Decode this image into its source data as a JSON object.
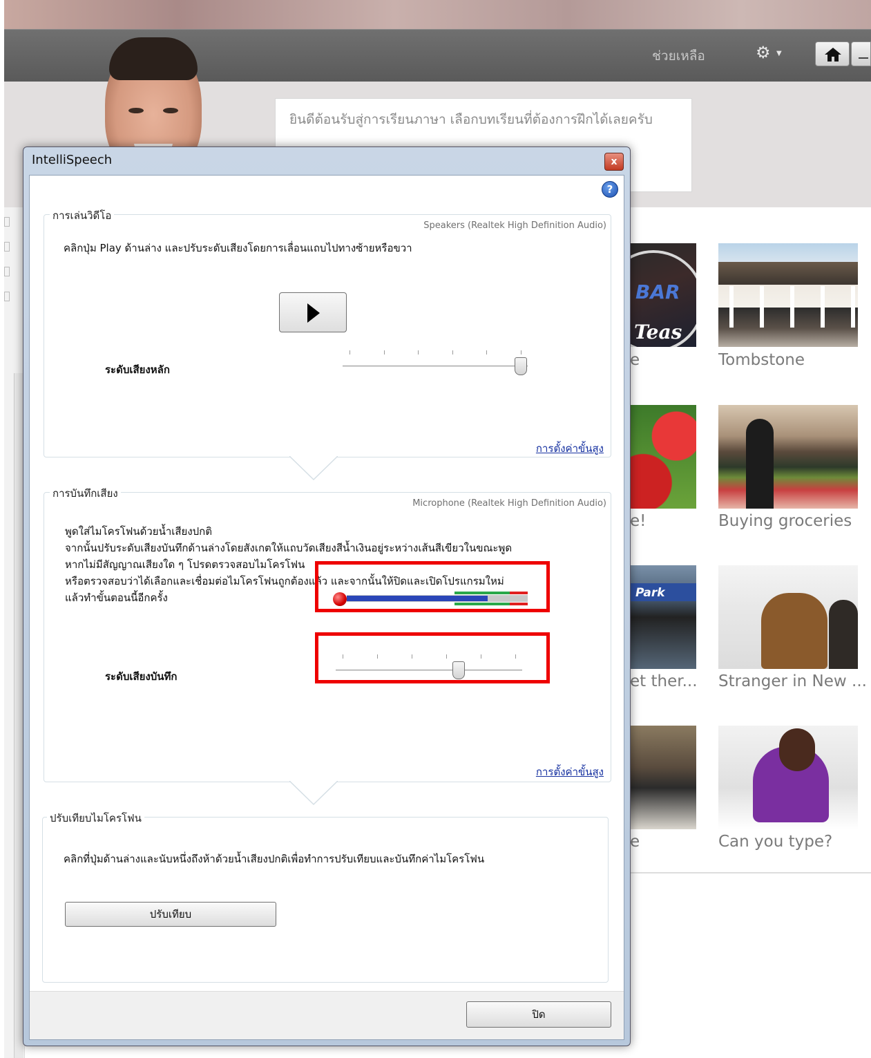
{
  "app": {
    "help_link": "ช่วยเหลือ",
    "welcome_text": "ยินดีต้อนรับสู่การเรียนภาษา เลือกบทเรียนที่ต้องการฝึกได้เลยครับ",
    "lessons": [
      {
        "label": "Tombstone"
      },
      {
        "label": "Buying groceries"
      },
      {
        "label": "Stranger in New ..."
      },
      {
        "label": "Can you type?"
      }
    ],
    "partial_lessons": [
      {
        "label": "e"
      },
      {
        "label": "e!"
      },
      {
        "label": "et ther..."
      },
      {
        "label": "e"
      }
    ],
    "partial_overlay_text": {
      "bar": "BAR",
      "teas": "Teas",
      "park": "Park"
    }
  },
  "dialog": {
    "title": "IntelliSpeech",
    "close_glyph": "x",
    "help_glyph": "?",
    "playback": {
      "group_title": "การเล่นวิดีโอ",
      "device": "Speakers (Realtek High Definition Audio)",
      "instruction": "คลิกปุ่ม Play ด้านล่าง และปรับระดับเสียงโดยการเลื่อนแถบไปทางซ้ายหรือขวา",
      "slider_label": "ระดับเสียงหลัก",
      "volume_level": 1.0,
      "advanced_link": "การตั้งค่าขั้นสูง"
    },
    "recording": {
      "group_title": "การบันทึกเสียง",
      "device": "Microphone (Realtek High Definition Audio)",
      "instructions": [
        "พูดใส่ไมโครโฟนด้วยน้ำเสียงปกติ",
        "จากนั้นปรับระดับเสียงบันทึกด้านล่างโดยสังเกตให้แถบวัดเสียงสีน้ำเงินอยู่ระหว่างเส้นสีเขียวในขณะพูด",
        "หากไม่มีสัญญาณเสียงใด ๆ โปรดตรวจสอบไมโครโฟน",
        "หรือตรวจสอบว่าได้เลือกและเชื่อมต่อไมโครโฟนถูกต้องแล้ว และจากนั้นให้ปิดและเปิดโปรแกรมใหม่",
        "แล้วทำขั้นตอนนี้อีกครั้ง"
      ],
      "meter_level": 0.78,
      "slider_label": "ระดับเสียงบันทึก",
      "record_level": 0.67,
      "advanced_link": "การตั้งค่าขั้นสูง"
    },
    "calibration": {
      "group_title": "ปรับเทียบไมโครโฟน",
      "instruction": "คลิกที่ปุ่มด้านล่างและนับหนึ่งถึงห้าด้วยน้ำเสียงปกติเพื่อทำการปรับเทียบและบันทึกค่าไมโครโฟน",
      "button_label": "ปรับเทียบ"
    },
    "close_button_label": "ปิด"
  },
  "colors": {
    "highlight": "#ee0000",
    "meter_blue": "#2a46b8",
    "meter_green": "#2aa84a",
    "meter_red": "#e02020",
    "link": "#1530a0"
  }
}
